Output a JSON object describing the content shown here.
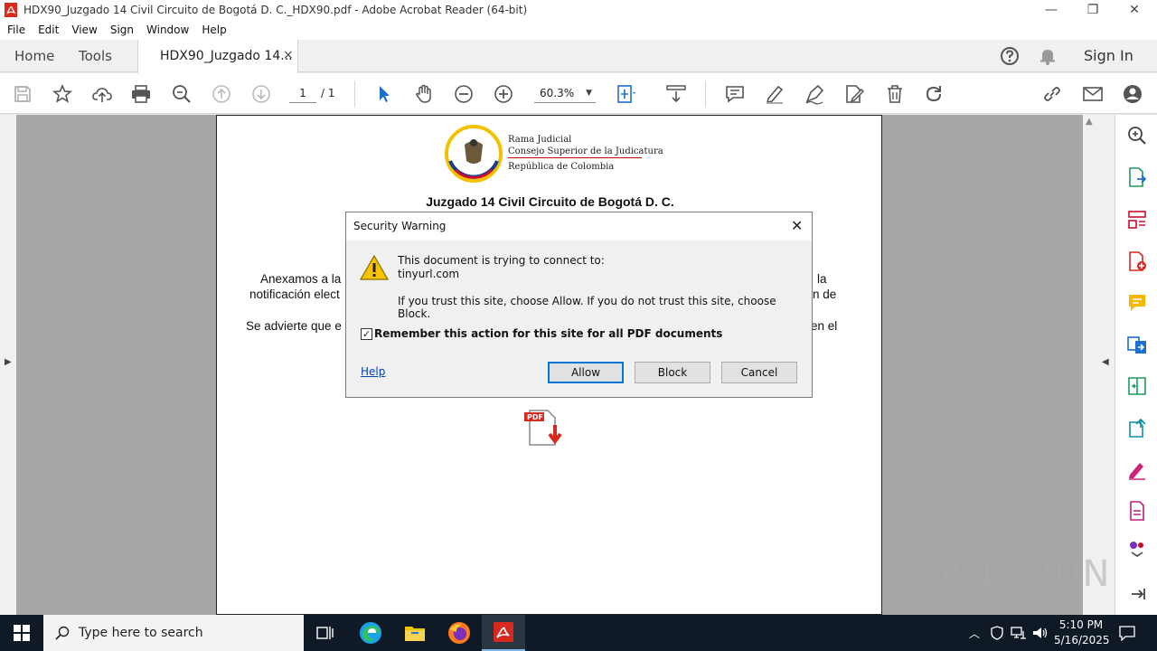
{
  "window": {
    "title": "HDX90_Juzgado 14 Civil Circuito de Bogotá D. C._HDX90.pdf - Adobe Acrobat Reader (64-bit)"
  },
  "menu": [
    "File",
    "Edit",
    "View",
    "Sign",
    "Window",
    "Help"
  ],
  "tabs": {
    "home": "Home",
    "tools": "Tools",
    "document": "HDX90_Juzgado 14...",
    "close": "×"
  },
  "header": {
    "signin": "Sign In"
  },
  "toolbar": {
    "page_current": "1",
    "page_total": "/ 1",
    "zoom": "60.3%"
  },
  "page": {
    "logo_line1": "Rama Judicial",
    "logo_line2": "Consejo Superior de la Judicatura",
    "logo_line3": "República de Colombia",
    "court": "Juzgado 14 Civil Circuito de Bogotá D. C.",
    "line1_left": "Anexamos a la",
    "line1_right": "la",
    "line2_left": "notificación elect",
    "line2_right": "n de",
    "line3_left": "Se advierte que e",
    "line3_right": "en el"
  },
  "dialog": {
    "title": "Security Warning",
    "line1": "This document is trying to connect to:",
    "url": "tinyurl.com",
    "line2": "If you trust this site, choose Allow. If you do not trust this site, choose Block.",
    "remember": "Remember this action for this site for all PDF documents",
    "remember_checked": true,
    "help": "Help",
    "allow": "Allow",
    "block": "Block",
    "cancel": "Cancel"
  },
  "taskbar": {
    "search_placeholder": "Type here to search",
    "time": "5:10 PM",
    "date": "5/16/2025"
  },
  "watermark": "ANY RUN",
  "colors": {
    "accent": "#0078d7",
    "pdf_red": "#d8291e",
    "taskbar": "#0f1a26"
  }
}
